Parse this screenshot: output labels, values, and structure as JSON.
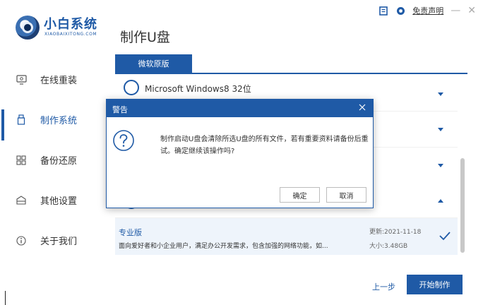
{
  "app": {
    "logo_cn": "小白系统",
    "logo_en": "XIAOBAIXITONG.COM",
    "page_title": "制作U盘"
  },
  "topbar": {
    "disclaimer": "免责声明",
    "minimize_glyph": "—",
    "close_glyph": "✕"
  },
  "sidebar": {
    "items": [
      {
        "label": "在线重装",
        "icon": "monitor-icon"
      },
      {
        "label": "制作系统",
        "icon": "usb-icon"
      },
      {
        "label": "备份还原",
        "icon": "grid-icon"
      },
      {
        "label": "其他设置",
        "icon": "box-icon"
      },
      {
        "label": "关于我们",
        "icon": "info-icon"
      }
    ],
    "active_index": 1
  },
  "main": {
    "tab_label": "微软原版",
    "os_list": [
      {
        "name": "Microsoft Windows8 32位",
        "expanded": false
      },
      {
        "name": "",
        "expanded": false
      },
      {
        "name": "",
        "expanded": false
      },
      {
        "name": "",
        "expanded": true
      }
    ],
    "selected": {
      "title": "专业版",
      "description": "面向爱好者和小企业用户，满足办公开发需求，包含加强的网络功能，如...",
      "update": "更新:2021-11-18",
      "size": "大小:3.48GB"
    },
    "prev_label": "上一步",
    "start_label": "开始制作"
  },
  "dialog": {
    "title": "警告",
    "message": "制作启动U盘会清除所选U盘的所有文件，若有重要资料请备份后重试。确定继续该操作吗?",
    "ok_label": "确定",
    "cancel_label": "取消"
  },
  "colors": {
    "accent": "#1f5aa6",
    "selected_row_bg": "#eef4fb"
  }
}
